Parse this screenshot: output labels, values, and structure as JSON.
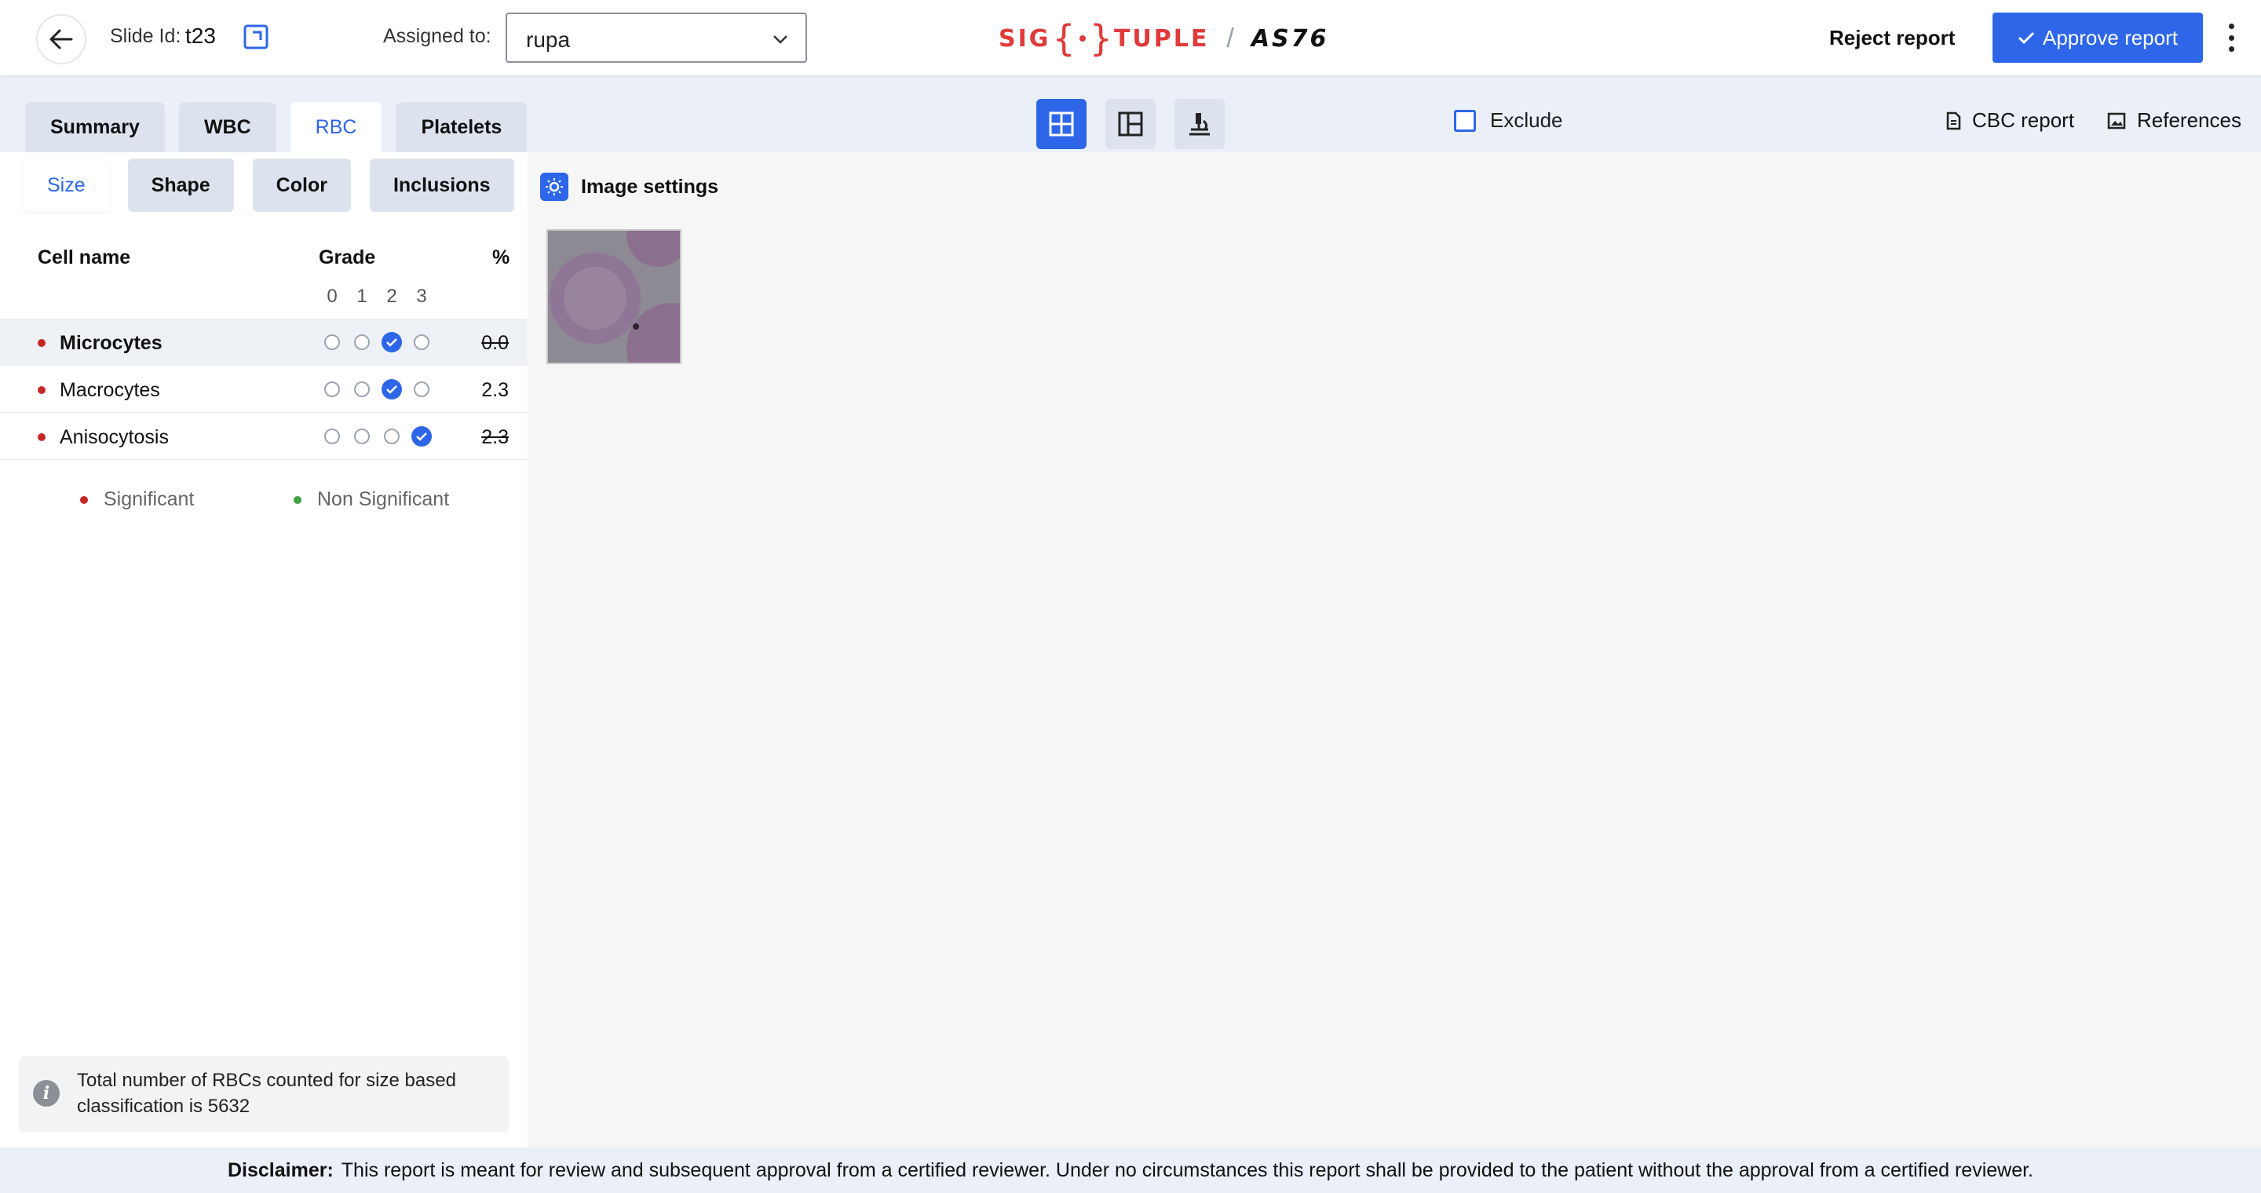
{
  "header": {
    "slide_label": "Slide Id:",
    "slide_id": "t23",
    "assigned_label": "Assigned to:",
    "assigned_value": "rupa",
    "logo": {
      "left": "SIG",
      "right": "TUPLE",
      "separator": "/",
      "model": "AS76"
    },
    "reject_label": "Reject report",
    "approve_label": "Approve report",
    "accent_color": "#2d66e8",
    "brand_color": "#e03a3a"
  },
  "tabs": [
    {
      "label": "Summary",
      "active": false
    },
    {
      "label": "WBC",
      "active": false
    },
    {
      "label": "RBC",
      "active": true
    },
    {
      "label": "Platelets",
      "active": false
    }
  ],
  "toolbar": {
    "views": [
      {
        "icon": "grid-view-icon",
        "active": true
      },
      {
        "icon": "split-view-icon",
        "active": false
      },
      {
        "icon": "microscope-icon",
        "active": false
      }
    ],
    "exclude_label": "Exclude",
    "exclude_checked": false,
    "cbc_label": "CBC report",
    "references_label": "References"
  },
  "subtabs": [
    {
      "label": "Size",
      "active": true
    },
    {
      "label": "Shape",
      "active": false
    },
    {
      "label": "Color",
      "active": false
    },
    {
      "label": "Inclusions",
      "active": false
    }
  ],
  "table": {
    "col_name": "Cell name",
    "col_grade": "Grade",
    "col_pct": "%",
    "grades": [
      "0",
      "1",
      "2",
      "3"
    ],
    "rows": [
      {
        "name": "Microcytes",
        "grade": 2,
        "pct": "0.0",
        "strike": true,
        "selected": true,
        "significant": true
      },
      {
        "name": "Macrocytes",
        "grade": 2,
        "pct": "2.3",
        "strike": false,
        "selected": false,
        "significant": true
      },
      {
        "name": "Anisocytosis",
        "grade": 3,
        "pct": "2.3",
        "strike": true,
        "selected": false,
        "significant": true
      }
    ]
  },
  "legend": {
    "significant": "Significant",
    "non_significant": "Non Significant",
    "significant_color": "#c62828",
    "non_significant_color": "#43a047"
  },
  "info": {
    "text": "Total number of RBCs counted for size based classification is 5632"
  },
  "main": {
    "image_settings_label": "Image settings"
  },
  "footer": {
    "label": "Disclaimer:",
    "text": "This report is meant for review and subsequent approval from a certified reviewer. Under no circumstances this report shall be provided to the patient without the approval from a certified reviewer."
  }
}
